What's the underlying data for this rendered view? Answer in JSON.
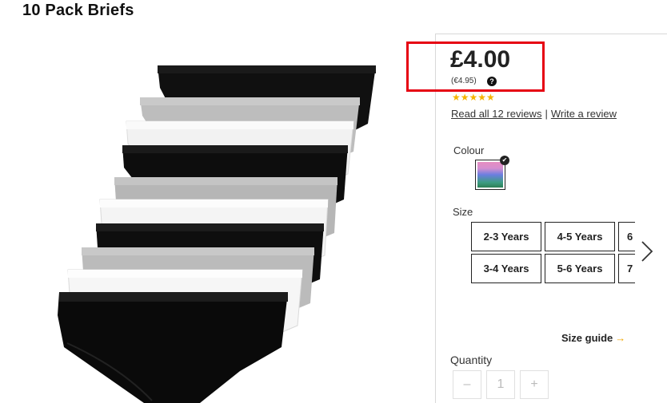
{
  "product": {
    "title": "10 Pack Briefs",
    "price": "£4.00",
    "price_alt": "(€4.95)",
    "rating_stars": 5,
    "stars_text": "★★★★★",
    "read_reviews": "Read all 12 reviews",
    "separator": "|",
    "write_review": "Write a review"
  },
  "colour": {
    "label": "Colour",
    "selected_check": "✔"
  },
  "size": {
    "label": "Size",
    "options": [
      "2-3 Years",
      "4-5 Years",
      "6",
      "3-4 Years",
      "5-6 Years",
      "7"
    ],
    "guide_label": "Size guide",
    "guide_arrow": "→"
  },
  "quantity": {
    "label": "Quantity",
    "minus": "–",
    "value": "1",
    "plus": "+"
  },
  "help_icon_glyph": "?",
  "colors": {
    "accent_red": "#e60012",
    "star": "#f5b400",
    "guide_arrow": "#f0a500"
  }
}
